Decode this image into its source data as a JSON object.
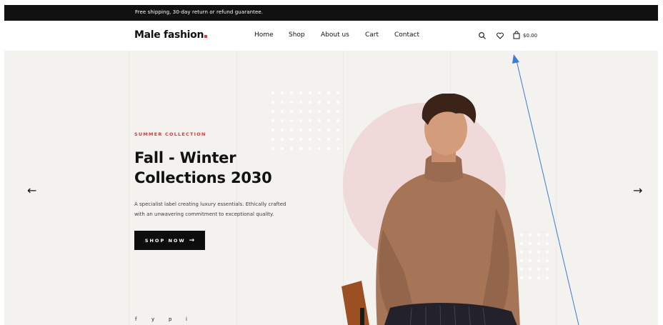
{
  "announcement": {
    "text": "Free shipping, 30-day return or refund guarantee."
  },
  "header": {
    "logo": "Male fashion",
    "nav": [
      {
        "label": "Home"
      },
      {
        "label": "Shop"
      },
      {
        "label": "About us"
      },
      {
        "label": "Cart"
      },
      {
        "label": "Contact"
      }
    ],
    "icons": [
      "search-icon",
      "heart-icon",
      "shopping-bag-icon"
    ],
    "cart_price": "$0.00"
  },
  "hero": {
    "subtitle": "SUMMER COLLECTION",
    "title_line1": "Fall - Winter",
    "title_line2": "Collections 2030",
    "description_line1": "A specialist label creating luxury essentials. Ethically crafted",
    "description_line2": "with an unwavering commitment to exceptional quality.",
    "button_label": "SHOP NOW",
    "prev_arrow": "←",
    "next_arrow": "→",
    "social": [
      "f",
      "y",
      "p",
      "i"
    ]
  },
  "colors": {
    "accent": "#e53637",
    "topbar": "#111111",
    "hero_bg": "#f3f2ee",
    "circle": "#f0d9d9",
    "annotation": "#3a7bd5"
  }
}
